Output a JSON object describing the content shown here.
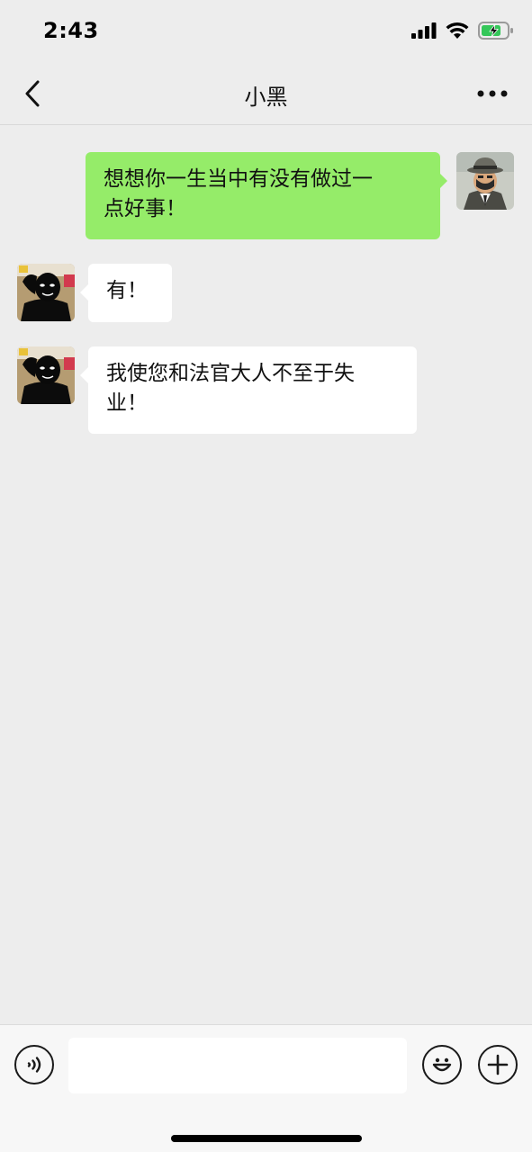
{
  "status_bar": {
    "time": "2:43"
  },
  "nav": {
    "title": "小黑",
    "back_icon": "chevron-left-icon",
    "more_icon": "more-dots-icon"
  },
  "messages": [
    {
      "side": "right",
      "text_line1": "想想你一生当中有没有做过一",
      "text_line2": "点好事！"
    },
    {
      "side": "left",
      "text_line1": "有！"
    },
    {
      "side": "left",
      "text_line1": "我使您和法官大人不至于失",
      "text_line2": "业！"
    }
  ],
  "input_bar": {
    "voice_icon": "voice-icon",
    "emoji_icon": "emoji-icon",
    "plus_icon": "plus-icon",
    "input_value": ""
  },
  "colors": {
    "background": "#ededed",
    "sent_bubble": "#95ec69",
    "received_bubble": "#ffffff"
  }
}
